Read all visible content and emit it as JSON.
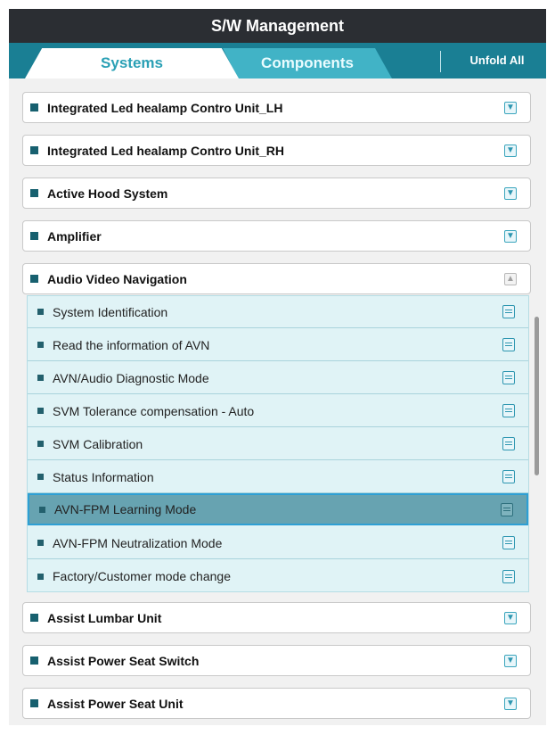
{
  "window": {
    "title": "S/W Management"
  },
  "tabs": {
    "systems": "Systems",
    "components": "Components",
    "unfold_all": "Unfold All"
  },
  "items_top": [
    {
      "label": "Integrated Led healamp Contro Unit_LH",
      "icon": "download-icon"
    },
    {
      "label": "Integrated Led healamp Contro Unit_RH",
      "icon": "download-icon"
    },
    {
      "label": "Active Hood System",
      "icon": "download-icon"
    },
    {
      "label": "Amplifier",
      "icon": "download-icon"
    },
    {
      "label": "Audio Video Navigation",
      "icon": "upload-icon-disabled",
      "expanded": true
    }
  ],
  "sub_items": [
    {
      "label": "System Identification",
      "selected": false
    },
    {
      "label": "Read the information of AVN",
      "selected": false
    },
    {
      "label": "AVN/Audio Diagnostic Mode",
      "selected": false
    },
    {
      "label": "SVM Tolerance compensation - Auto",
      "selected": false
    },
    {
      "label": "SVM Calibration",
      "selected": false
    },
    {
      "label": "Status Information",
      "selected": false
    },
    {
      "label": "AVN-FPM Learning Mode",
      "selected": true
    },
    {
      "label": "AVN-FPM Neutralization Mode",
      "selected": false
    },
    {
      "label": "Factory/Customer mode change",
      "selected": false
    }
  ],
  "items_bottom": [
    {
      "label": "Assist Lumbar Unit",
      "icon": "download-icon"
    },
    {
      "label": "Assist Power Seat Switch",
      "icon": "download-icon"
    },
    {
      "label": "Assist Power Seat Unit",
      "icon": "download-icon"
    }
  ],
  "colors": {
    "titlebar": "#2b2e33",
    "tab_bar": "#1a7f94",
    "tab_active_text": "#2aa0b5",
    "tab_inactive_bg": "#41b3c6",
    "sub_list_bg": "#e0f3f6",
    "selected_bg": "#67a3b1",
    "selected_border": "#2e9fd4"
  }
}
